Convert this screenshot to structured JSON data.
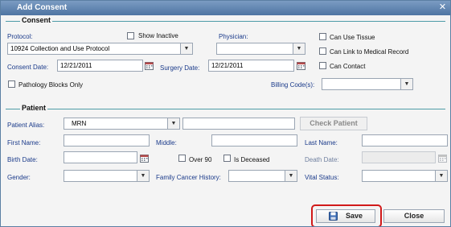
{
  "dialog": {
    "title": "Add Consent",
    "close_glyph": "✕"
  },
  "consent": {
    "legend": "Consent",
    "protocol_label": "Protocol:",
    "protocol_value": "10924 Collection and Use Protocol",
    "show_inactive_label": "Show Inactive",
    "physician_label": "Physician:",
    "physician_value": "",
    "can_use_tissue_label": "Can Use Tissue",
    "can_link_label": "Can Link to Medical Record",
    "can_contact_label": "Can Contact",
    "consent_date_label": "Consent Date:",
    "consent_date_value": "12/21/2011",
    "surgery_date_label": "Surgery Date:",
    "surgery_date_value": "12/21/2011",
    "pathology_blocks_label": "Pathology Blocks Only",
    "billing_codes_label": "Billing Code(s):",
    "billing_codes_value": ""
  },
  "patient": {
    "legend": "Patient",
    "alias_label": "Patient Alias:",
    "alias_type_value": "MRN",
    "alias_value": "",
    "check_patient_label": "Check Patient",
    "first_name_label": "First Name:",
    "middle_label": "Middle:",
    "last_name_label": "Last Name:",
    "birth_date_label": "Birth Date:",
    "over_90_label": "Over 90",
    "is_deceased_label": "Is Deceased",
    "death_date_label": "Death Date:",
    "gender_label": "Gender:",
    "family_cancer_label": "Family Cancer History:",
    "vital_status_label": "Vital Status:"
  },
  "footer": {
    "save_label": "Save",
    "close_label": "Close"
  },
  "icons": {
    "dropdown_arrow": "▼",
    "calendar": "calendar-icon",
    "save": "floppy-disk-icon"
  },
  "colors": {
    "titlebar": "#4e74a2",
    "label_blue": "#1a3a8a",
    "section_rule": "#4e9ca7",
    "highlight": "#d11a1a"
  }
}
